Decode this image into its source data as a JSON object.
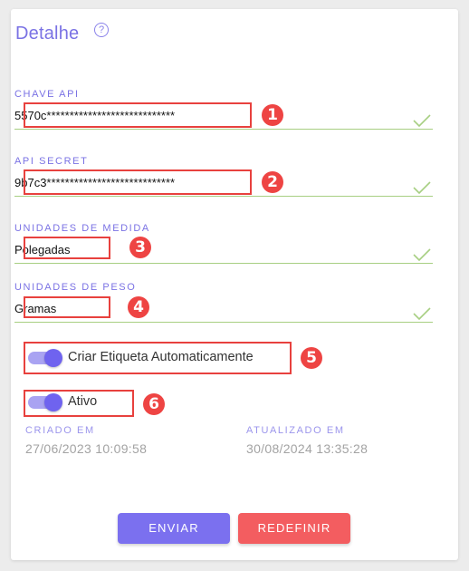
{
  "panel": {
    "title": "Detalhe",
    "help_icon": "question-circle-icon"
  },
  "fields": {
    "api_key": {
      "label": "CHAVE API",
      "value": "5570c****************************"
    },
    "api_secret": {
      "label": "API SECRET",
      "value": "9b7c3****************************"
    },
    "measure_units": {
      "label": "UNIDADES DE MEDIDA",
      "value": "Polegadas"
    },
    "weight_units": {
      "label": "UNIDADES DE PESO",
      "value": "Gramas"
    }
  },
  "toggles": {
    "auto_label": {
      "label": "Criar Etiqueta Automaticamente",
      "on": true
    },
    "active": {
      "label": "Ativo",
      "on": true
    }
  },
  "meta": {
    "created_label": "CRIADO EM",
    "created_value": "27/06/2023 10:09:58",
    "updated_label": "ATUALIZADO EM",
    "updated_value": "30/08/2024 13:35:28"
  },
  "buttons": {
    "send": "ENVIAR",
    "reset": "REDEFINIR"
  },
  "annotations": [
    "1",
    "2",
    "3",
    "4",
    "5",
    "6"
  ],
  "colors": {
    "accent": "#7a72e4",
    "valid": "#a7cf82",
    "reset": "#f35d60",
    "highlight": "#e8413e"
  }
}
